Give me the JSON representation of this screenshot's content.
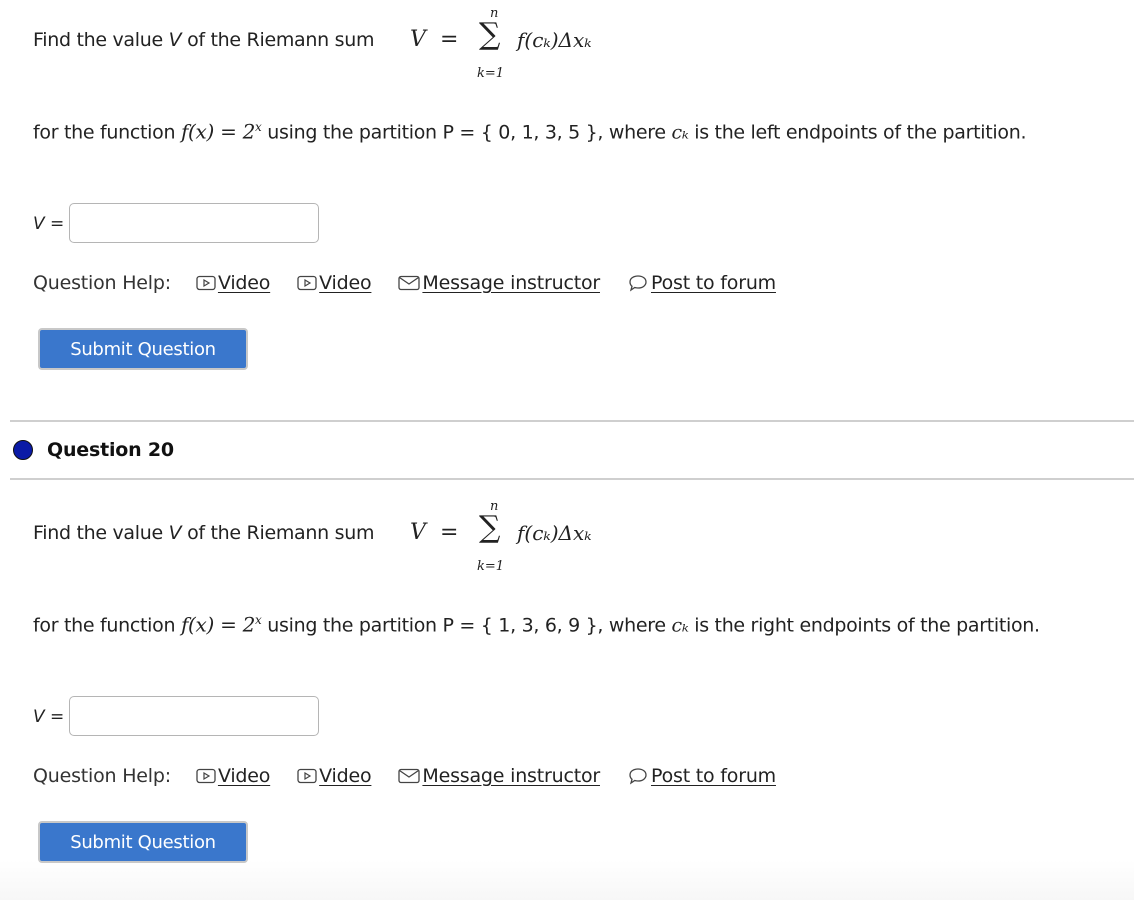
{
  "questions": [
    {
      "intro": "Find the value ",
      "intro_var": "V",
      "intro_tail": " of the Riemann sum ",
      "formula": {
        "lhs": "V",
        "eq": "=",
        "sum_upper": "n",
        "sum_symbol": "∑",
        "sum_lower": "k=1",
        "term": "f(cₖ)Δxₖ"
      },
      "body_prefix": "for the function ",
      "function": "f(x) = 2",
      "function_exp": "x",
      "body_middle": " using the partition P = { 0, 1, 3, 5 }, where ",
      "ck": "cₖ",
      "body_suffix": " is the left endpoints of the partition.",
      "answer_label": "V =",
      "answer_value": "",
      "help_label": "Question Help:",
      "help_links": [
        {
          "label": "Video",
          "icon": "video-play-icon"
        },
        {
          "label": "Video",
          "icon": "video-play-icon"
        },
        {
          "label": "Message instructor",
          "icon": "envelope-icon"
        },
        {
          "label": "Post to forum",
          "icon": "speech-bubble-icon"
        }
      ],
      "submit_label": "Submit Question"
    },
    {
      "header": "Question 20",
      "status_color": "#0a1aa6",
      "intro": "Find the value ",
      "intro_var": "V",
      "intro_tail": " of the Riemann sum ",
      "formula": {
        "lhs": "V",
        "eq": "=",
        "sum_upper": "n",
        "sum_symbol": "∑",
        "sum_lower": "k=1",
        "term": "f(cₖ)Δxₖ"
      },
      "body_prefix": "for the function ",
      "function": "f(x) = 2",
      "function_exp": "x",
      "body_middle": " using the partition P = { 1, 3, 6, 9 }, where ",
      "ck": "cₖ",
      "body_suffix": " is the right endpoints of the partition.",
      "answer_label": "V =",
      "answer_value": "",
      "help_label": "Question Help:",
      "help_links": [
        {
          "label": "Video",
          "icon": "video-play-icon"
        },
        {
          "label": "Video",
          "icon": "video-play-icon"
        },
        {
          "label": "Message instructor",
          "icon": "envelope-icon"
        },
        {
          "label": "Post to forum",
          "icon": "speech-bubble-icon"
        }
      ],
      "submit_label": "Submit Question"
    }
  ]
}
